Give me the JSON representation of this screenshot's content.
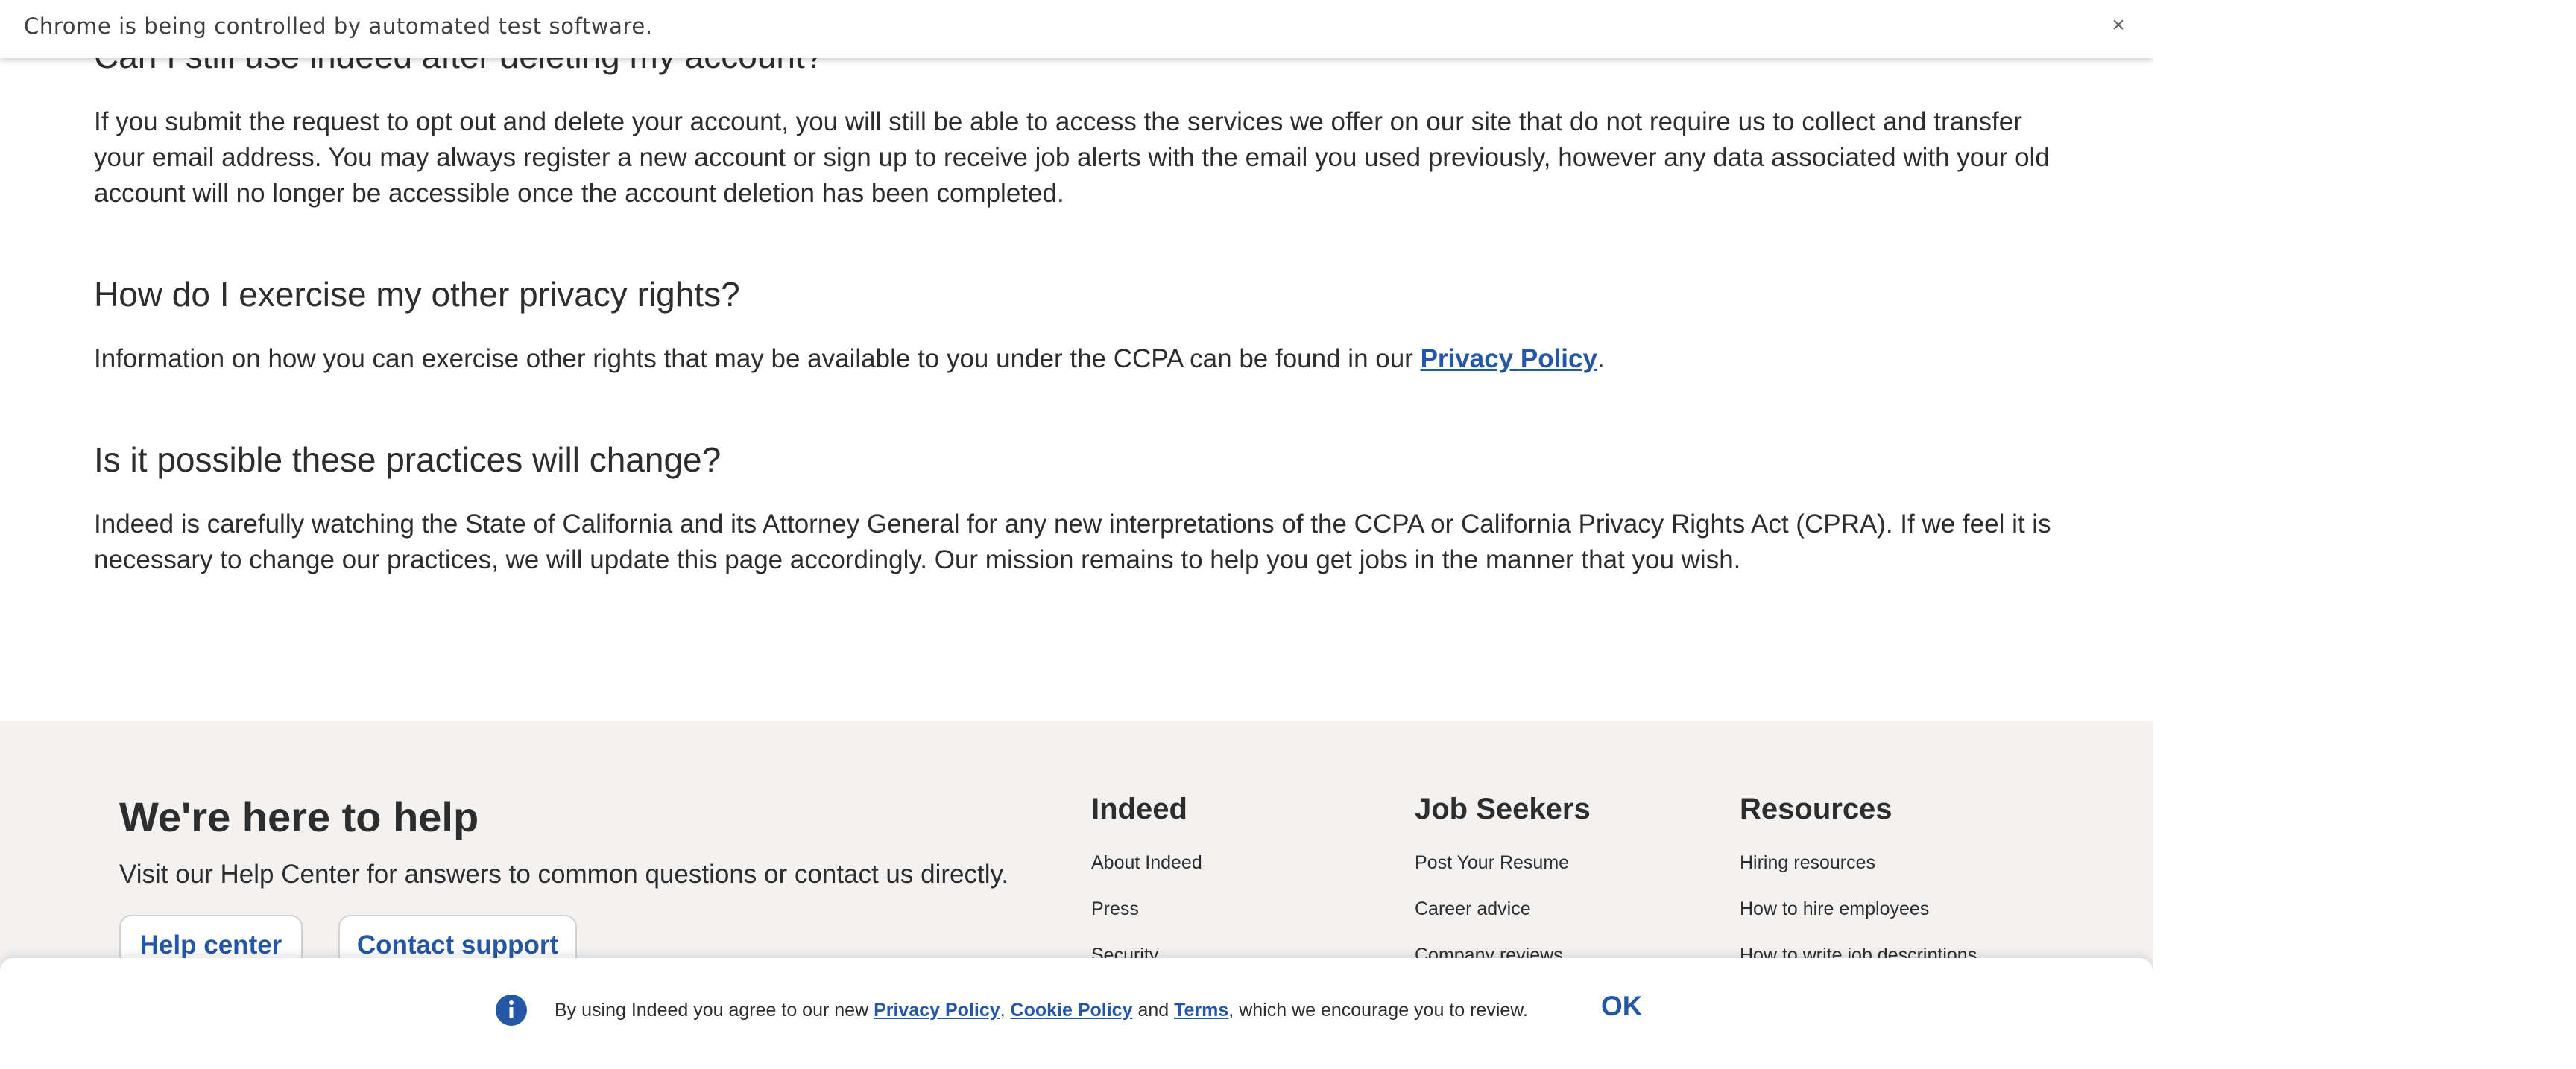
{
  "infobar": {
    "message": "Chrome is being controlled by automated test software.",
    "close_glyph": "×"
  },
  "article": {
    "section1": {
      "heading": "Can I still use indeed after deleting my account?",
      "body": "If you submit the request to opt out and delete your account, you will still be able to access the services we offer on our site that do not require us to collect and transfer your email address. You may always register a new account or sign up to receive job alerts with the email you used previously, however any data associated with your old account will no longer be accessible once the account deletion has been completed."
    },
    "section2": {
      "heading": "How do I exercise my other privacy rights?",
      "body_before": "Information on how you can exercise other rights that may be available to you under the CCPA can be found in our ",
      "link": "Privacy Policy",
      "body_after": "."
    },
    "section3": {
      "heading": "Is it possible these practices will change?",
      "body": "Indeed is carefully watching the State of California and its Attorney General for any new interpretations of the CCPA or California Privacy Rights Act (CPRA). If we feel it is necessary to change our practices, we will update this page accordingly. Our mission remains to help you get jobs in the manner that you wish."
    }
  },
  "footer": {
    "title": "We're here to help",
    "subtitle": "Visit our Help Center for answers to common questions or contact us directly.",
    "help_center_label": "Help center",
    "contact_support_label": "Contact support",
    "columns": [
      {
        "heading": "Indeed",
        "links": [
          "About Indeed",
          "Press",
          "Security"
        ]
      },
      {
        "heading": "Job Seekers",
        "links": [
          "Post Your Resume",
          "Career advice",
          "Company reviews"
        ]
      },
      {
        "heading": "Resources",
        "links": [
          "Hiring resources",
          "How to hire employees",
          "How to write job descriptions"
        ]
      }
    ]
  },
  "cookie_banner": {
    "text_start": "By using Indeed you agree to our new ",
    "privacy_link": "Privacy Policy",
    "sep1": ", ",
    "cookie_link": "Cookie Policy",
    "and": " and ",
    "terms_link": "Terms",
    "text_end": ", which we encourage you to review.",
    "ok_label": "OK",
    "icon": "info-icon"
  },
  "colors": {
    "link_blue": "#2557a7",
    "text": "#2d2d2d",
    "footer_bg": "#f3f2f1",
    "info_icon": "#2557a7"
  }
}
